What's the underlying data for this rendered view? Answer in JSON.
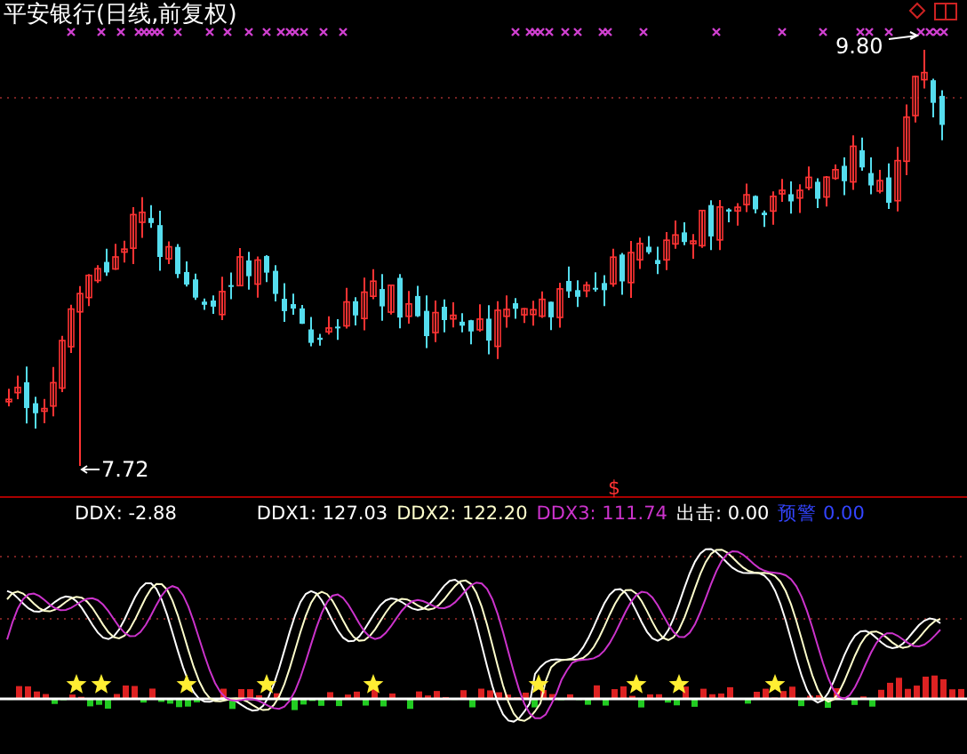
{
  "chart_title": "平安银行(日线,前复权)",
  "price_labels": [
    {
      "kind": "high",
      "text": "9.80"
    },
    {
      "kind": "low",
      "text": "7.72"
    }
  ],
  "signal_mark": "$",
  "indicator": {
    "readouts": [
      {
        "label": "DDX:",
        "value": "-2.88",
        "color": "#ffffff"
      },
      {
        "label": "DDX1:",
        "value": "127.03",
        "color": "#ffffff"
      },
      {
        "label": "DDX2:",
        "value": "122.20",
        "color": "#ffffcc"
      },
      {
        "label": "DDX3:",
        "value": "111.74",
        "color": "#cc33cc"
      },
      {
        "label": "出击:",
        "value": "0.00",
        "color": "#ffffff"
      },
      {
        "label": "预警",
        "value": "0.00",
        "color": "#3344ff"
      }
    ]
  }
}
